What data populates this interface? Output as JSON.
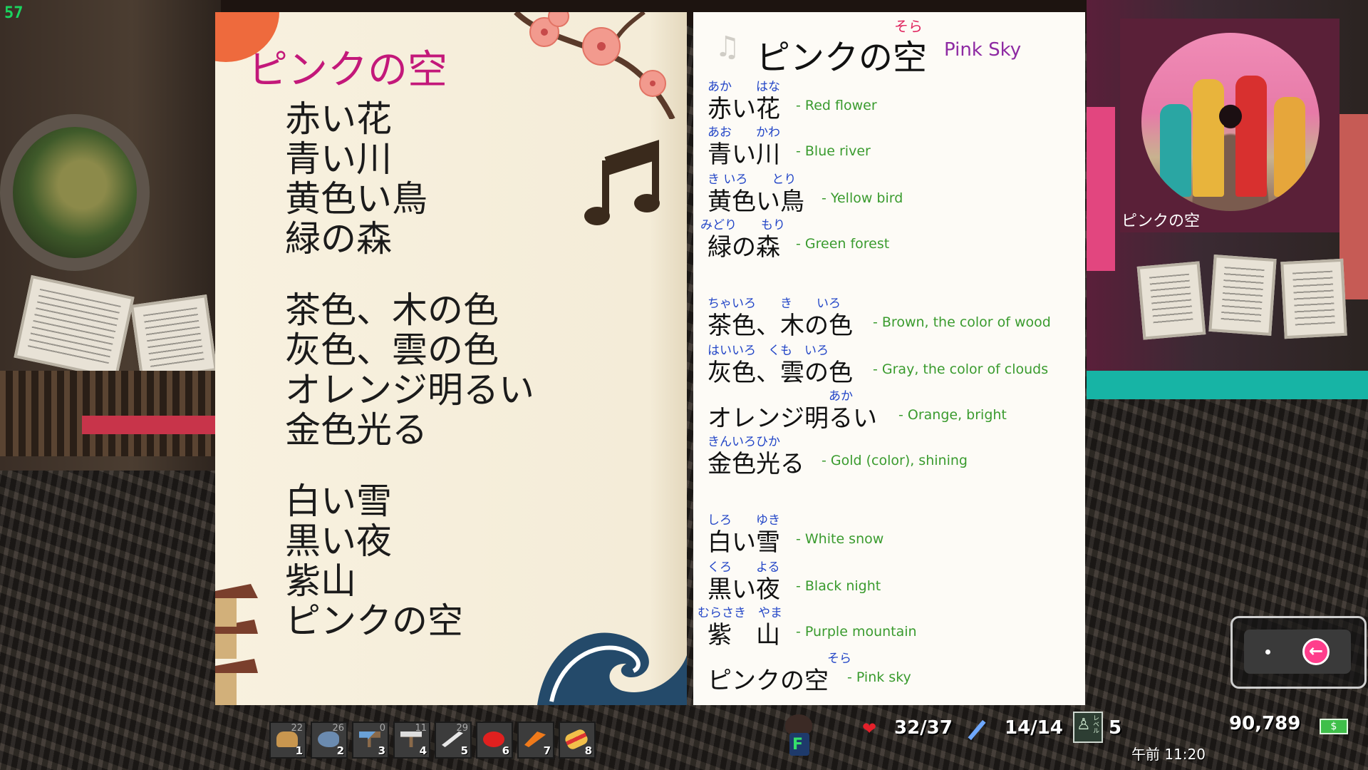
{
  "left_page": {
    "title": "ピンクの空",
    "lines": [
      "赤い花",
      "青い川",
      "黄色い鳥",
      "緑の森",
      "茶色、木の色",
      "灰色、雲の色",
      "オレンジ明るい",
      "金色光る",
      "白い雪",
      "黒い夜",
      "紫山",
      "ピンクの空"
    ]
  },
  "right_page": {
    "title": "ピンクの空",
    "title_furigana": "そら",
    "subtitle": "Pink Sky",
    "vocab": [
      {
        "kanji": "赤い花",
        "furigana": "あか　　はな",
        "english": "- Red flower"
      },
      {
        "kanji": "青い川",
        "furigana": "あお　　かわ",
        "english": "- Blue river"
      },
      {
        "kanji": "黄色い鳥",
        "furigana": "き いろ　　とり",
        "english": "- Yellow bird"
      },
      {
        "kanji": "緑の森",
        "furigana": "みどり　　もり",
        "english": "- Green forest"
      },
      {
        "kanji": "茶色、木の色",
        "furigana": "ちゃいろ　　き　　いろ",
        "english": "- Brown, the color of wood"
      },
      {
        "kanji": "灰色、雲の色",
        "furigana": "はいいろ　くも　いろ",
        "english": "- Gray, the color of clouds"
      },
      {
        "kanji": "オレンジ明るい",
        "furigana": "あか",
        "english": "- Orange, bright"
      },
      {
        "kanji": "金色光る",
        "furigana": "きんいろひか",
        "english": "- Gold (color), shining"
      },
      {
        "kanji": "白い雪",
        "furigana": "しろ　　ゆき",
        "english": "- White snow"
      },
      {
        "kanji": "黒い夜",
        "furigana": "くろ　　よる",
        "english": "- Black night"
      },
      {
        "kanji": "紫　山",
        "furigana": "むらさき　やま",
        "english": "- Purple mountain"
      },
      {
        "kanji": "ピンクの空",
        "furigana": "そら",
        "english": "- Pink sky"
      }
    ]
  },
  "album": {
    "label": "ピンクの空"
  },
  "hotbar": {
    "slots": [
      {
        "count": "22",
        "number": "1",
        "icon": "bread-icon"
      },
      {
        "count": "26",
        "number": "2",
        "icon": "fish-icon"
      },
      {
        "count": "0",
        "number": "3",
        "icon": "axe-icon"
      },
      {
        "count": "11",
        "number": "4",
        "icon": "hammer-icon"
      },
      {
        "count": "29",
        "number": "5",
        "icon": "sword-icon"
      },
      {
        "count": "",
        "number": "6",
        "icon": "apple-icon"
      },
      {
        "count": "",
        "number": "7",
        "icon": "carrot-icon"
      },
      {
        "count": "",
        "number": "8",
        "icon": "sandwich-icon"
      }
    ]
  },
  "hud": {
    "player_key": "F",
    "health": "32/37",
    "stamina": "14/14",
    "level_label": "レベル",
    "level": "5",
    "money": "90,789",
    "time": "午前 11:20",
    "corner_number": "57"
  },
  "colors": {
    "accent_pink": "#c3187a",
    "furigana_blue": "#2245c7",
    "english_green": "#3a9b2e",
    "subtitle_purple": "#8e2aa3",
    "back_button": "#ff3e8c"
  }
}
